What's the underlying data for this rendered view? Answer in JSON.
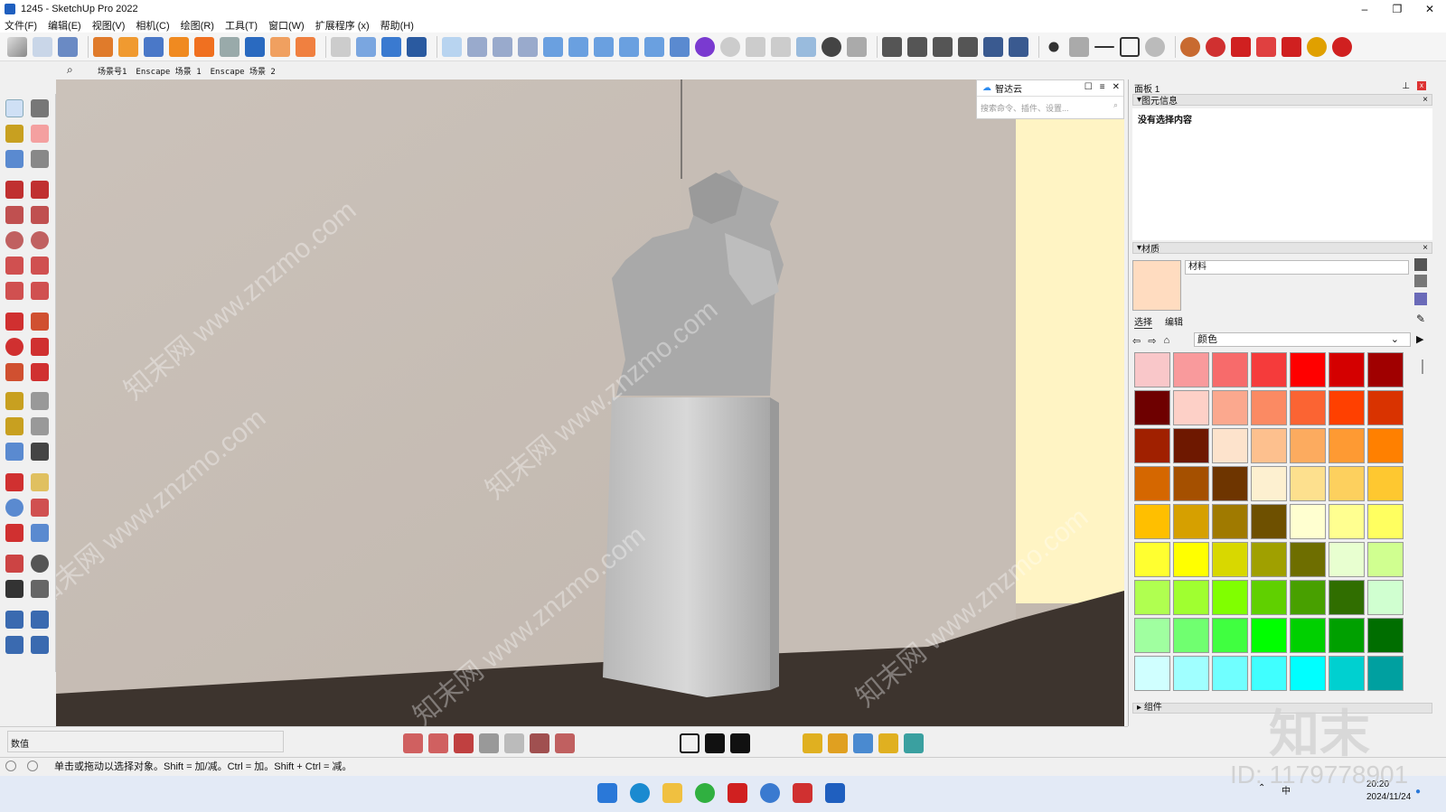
{
  "window": {
    "title": "1245 - SketchUp Pro 2022"
  },
  "menu": [
    "文件(F)",
    "编辑(E)",
    "视图(V)",
    "相机(C)",
    "绘图(R)",
    "工具(T)",
    "窗口(W)",
    "扩展程序 (x)",
    "帮助(H)"
  ],
  "scene_tabs": [
    "场景号1",
    "Enscape 场景 1",
    "Enscape 场景 2"
  ],
  "smart_cloud": {
    "title": "智达云",
    "placeholder": "搜索命令、插件、设置..."
  },
  "panel": {
    "title": "面板 1",
    "entity_info": {
      "header": "图元信息",
      "content": "没有选择内容"
    },
    "materials": {
      "header": "材质",
      "name": "材料",
      "tab_select": "选择",
      "tab_edit": "编辑",
      "library": "颜色",
      "current_color": "#ffdcc0",
      "swatches": [
        "#f9c7c9",
        "#f99a9c",
        "#f76b6b",
        "#f53b3b",
        "#ff0000",
        "#d40000",
        "#a00000",
        "#6e0000",
        "#fdd0c7",
        "#fba88e",
        "#fb8a63",
        "#fb6433",
        "#ff4000",
        "#d93300",
        "#a02000",
        "#6e1800",
        "#fde3cc",
        "#fdc08e",
        "#fcab5f",
        "#fe9a33",
        "#ff8000",
        "#d56700",
        "#a55000",
        "#6e3500",
        "#fdf0d0",
        "#fde08e",
        "#fdd05e",
        "#fec830",
        "#ffbf00",
        "#d6a000",
        "#a07a00",
        "#6e5000",
        "#ffffd0",
        "#ffff90",
        "#ffff60",
        "#ffff30",
        "#ffff00",
        "#d8d800",
        "#a0a000",
        "#6e6e00",
        "#e8ffd0",
        "#d0ff90",
        "#b0ff50",
        "#a0ff30",
        "#80ff00",
        "#60d000",
        "#48a000",
        "#306e00",
        "#d0ffd0",
        "#a0ffa0",
        "#70ff70",
        "#40ff40",
        "#00ff00",
        "#00d000",
        "#00a000",
        "#006e00",
        "#d0ffff",
        "#a0ffff",
        "#70ffff",
        "#40ffff",
        "#00ffff",
        "#00d0d0",
        "#00a0a0"
      ]
    },
    "components": {
      "header": "组件"
    }
  },
  "value_box": {
    "label": "数值"
  },
  "status": {
    "message": "单击或拖动以选择对象。Shift = 加/减。Ctrl = 加。Shift + Ctrl = 减。"
  },
  "taskbar": {
    "ime": "中",
    "time": "20:20",
    "date": "2024/11/24"
  },
  "watermark": {
    "id": "ID: 1179778901",
    "mark": "知末",
    "site": "知末网 www.znzmo.com"
  }
}
